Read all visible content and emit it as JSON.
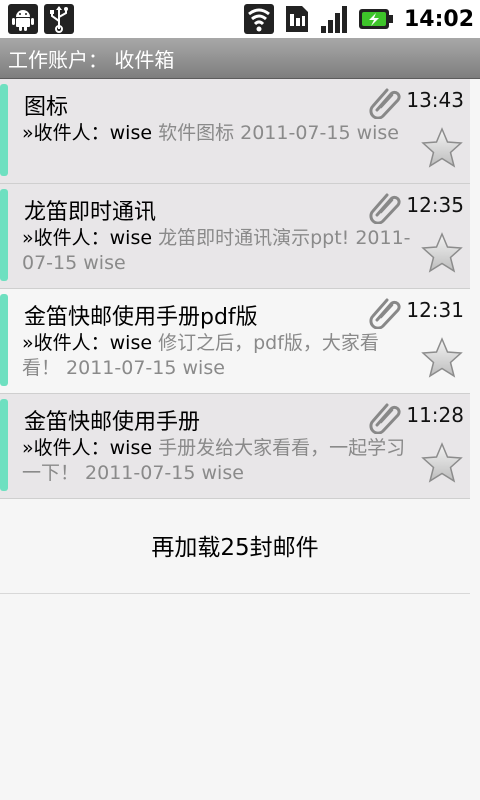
{
  "status_bar": {
    "time": "14:02",
    "icons": [
      "android-icon",
      "usb-icon",
      "wifi-icon",
      "sim-icon",
      "signal-icon",
      "battery-charging-icon"
    ]
  },
  "header": {
    "title": "工作账户：  收件箱"
  },
  "messages": [
    {
      "subject": "图标",
      "time": "13:43",
      "recipient": "»收件人：wise",
      "preview": " 软件图标 2011-07-15 wise",
      "has_attachment": true,
      "starred": false,
      "unread": true
    },
    {
      "subject": "龙笛即时通讯",
      "time": "12:35",
      "recipient": "»收件人：wise",
      "preview": " 龙笛即时通讯演示ppt! 2011-07-15 wise",
      "has_attachment": true,
      "starred": false,
      "unread": true
    },
    {
      "subject": "金笛快邮使用手册pdf版",
      "time": "12:31",
      "recipient": "»收件人：wise",
      "preview": " 修订之后，pdf版，大家看看！ 2011-07-15 wise",
      "has_attachment": true,
      "starred": false,
      "unread": false
    },
    {
      "subject": "金笛快邮使用手册",
      "time": "11:28",
      "recipient": "»收件人：wise",
      "preview": " 手册发给大家看看，一起学习一下！ 2011-07-15 wise",
      "has_attachment": true,
      "starred": false,
      "unread": true
    }
  ],
  "load_more": {
    "label": "再加载25封邮件"
  },
  "colors": {
    "accent": "#6ee0c0",
    "title_bar": "#8e8e8e",
    "unread_bg": "#e8e6e8"
  }
}
